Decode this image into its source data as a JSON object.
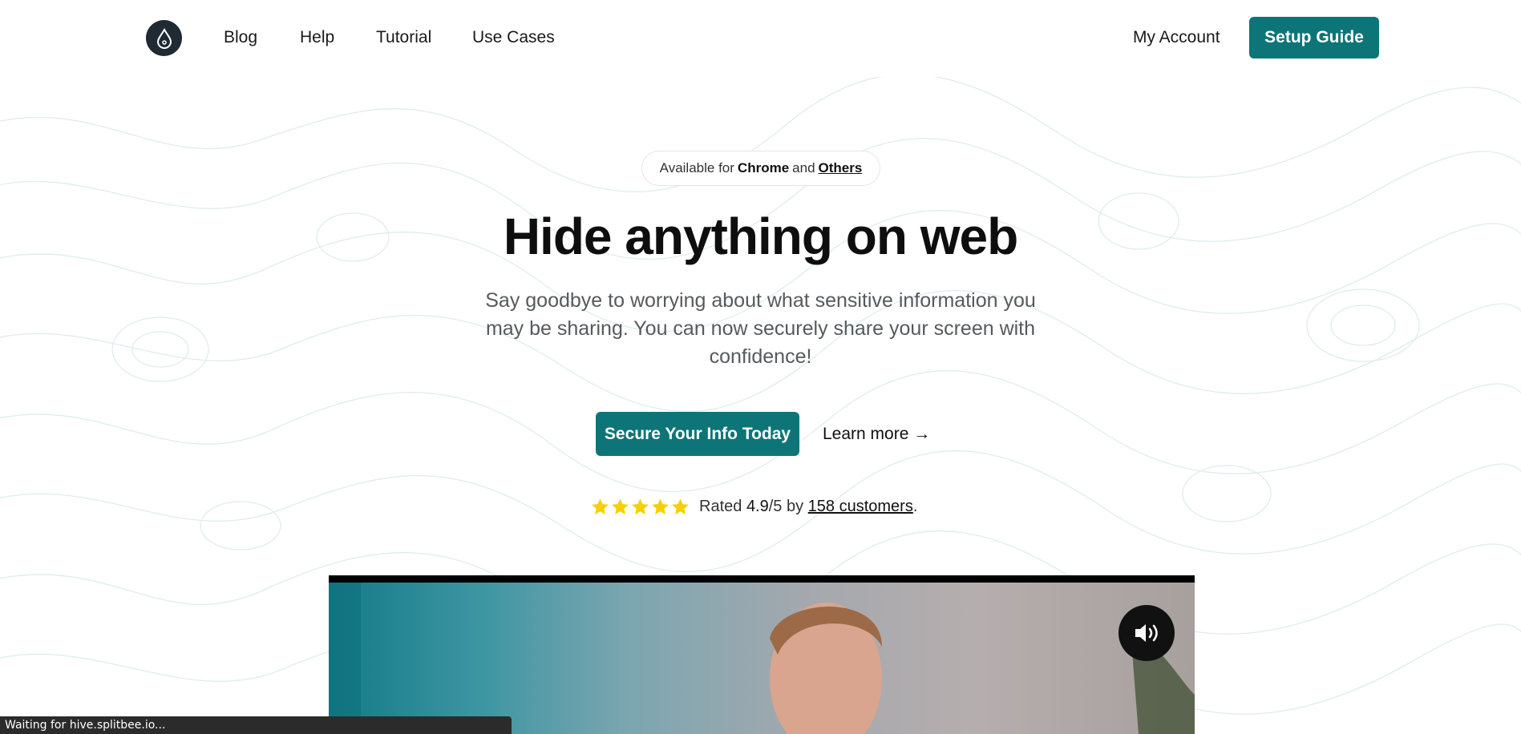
{
  "nav": {
    "links": [
      "Blog",
      "Help",
      "Tutorial",
      "Use Cases"
    ],
    "account": "My Account",
    "setup_guide": "Setup Guide"
  },
  "hero": {
    "available_prefix": "Available for",
    "available_chrome": "Chrome",
    "available_and": "and",
    "available_others": "Others",
    "title": "Hide anything on web",
    "subtitle": "Say goodbye to worrying about what sensitive information you may be sharing. You can now securely share your screen with confidence!",
    "cta": "Secure Your Info Today",
    "learn_more": "Learn more →"
  },
  "rating": {
    "stars": 5,
    "prefix": "Rated",
    "score": "4.9",
    "suffix": "/5 by",
    "customers": "158 customers",
    "end": "."
  },
  "status_bar": "Waiting for hive.splitbee.io...",
  "colors": {
    "accent": "#0d7577",
    "star": "#f5d000",
    "logo_bg": "#1f2a33"
  },
  "icons": {
    "logo": "drop-logo-icon",
    "star": "star-icon",
    "mute": "volume-icon"
  }
}
